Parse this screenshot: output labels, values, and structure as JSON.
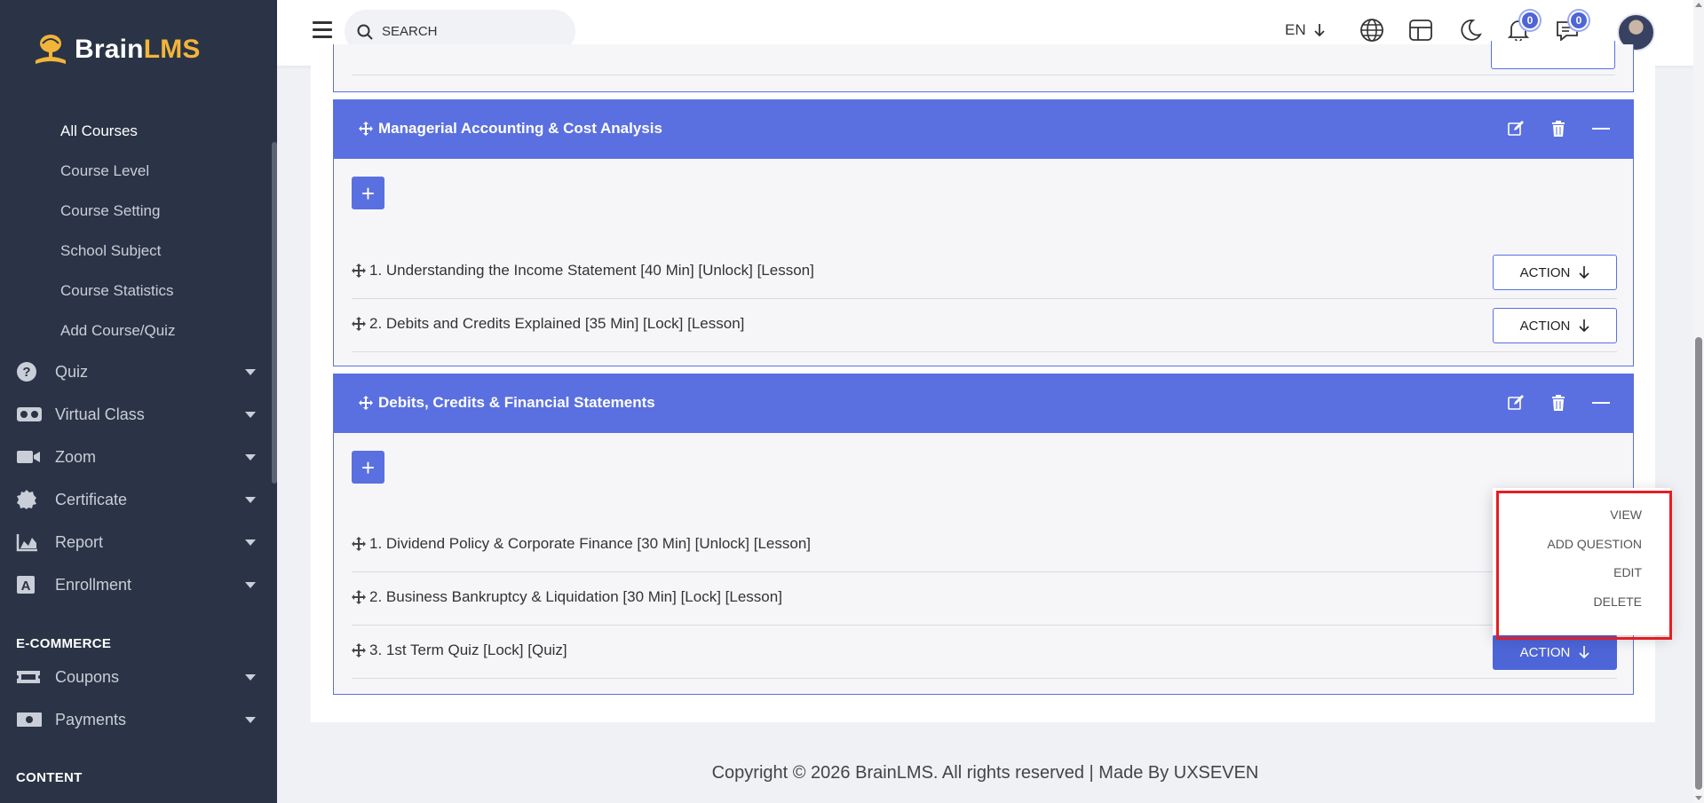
{
  "app": {
    "name_part1": "Brain",
    "name_part2": "LMS"
  },
  "sidebar": {
    "sub_items": [
      "All Courses",
      "Course Level",
      "Course Setting",
      "School Subject",
      "Course Statistics",
      "Add Course/Quiz"
    ],
    "menu": [
      {
        "label": "Quiz",
        "icon": "question-circle-icon"
      },
      {
        "label": "Virtual Class",
        "icon": "vr-headset-icon"
      },
      {
        "label": "Zoom",
        "icon": "video-camera-icon"
      },
      {
        "label": "Certificate",
        "icon": "certificate-icon"
      },
      {
        "label": "Report",
        "icon": "area-chart-icon"
      },
      {
        "label": "Enrollment",
        "icon": "enrollment-icon"
      }
    ],
    "ecommerce_heading": "E-COMMERCE",
    "ecommerce_menu": [
      {
        "label": "Coupons",
        "icon": "ticket-icon"
      },
      {
        "label": "Payments",
        "icon": "money-icon"
      }
    ],
    "content_heading": "CONTENT"
  },
  "header": {
    "search_placeholder": "SEARCH",
    "language": "EN",
    "notification_count": "0",
    "message_count": "0"
  },
  "sections": [
    {
      "title": "Managerial Accounting & Cost Analysis",
      "lessons": [
        {
          "text": "1. Understanding the Income Statement [40 Min] [Unlock] [Lesson]",
          "action": "ACTION"
        },
        {
          "text": "2. Debits and Credits Explained [35 Min] [Lock] [Lesson]",
          "action": "ACTION"
        }
      ]
    },
    {
      "title": "Debits, Credits & Financial Statements",
      "lessons": [
        {
          "text": "1. Dividend Policy & Corporate Finance [30 Min] [Unlock] [Lesson]"
        },
        {
          "text": "2. Business Bankruptcy & Liquidation [30 Min] [Lock] [Lesson]"
        },
        {
          "text": "3. 1st Term Quiz [Lock] [Quiz]",
          "action": "ACTION"
        }
      ]
    }
  ],
  "dropdown": {
    "options": [
      "VIEW",
      "ADD QUESTION",
      "EDIT",
      "DELETE"
    ]
  },
  "footer": {
    "text": "Copyright © 2026 BrainLMS. All rights reserved | Made By UXSEVEN"
  },
  "colors": {
    "primary": "#5a70e0",
    "sidebar_bg": "#2b3446",
    "highlight": "#e41e24",
    "logo_accent": "#f2b53a"
  }
}
